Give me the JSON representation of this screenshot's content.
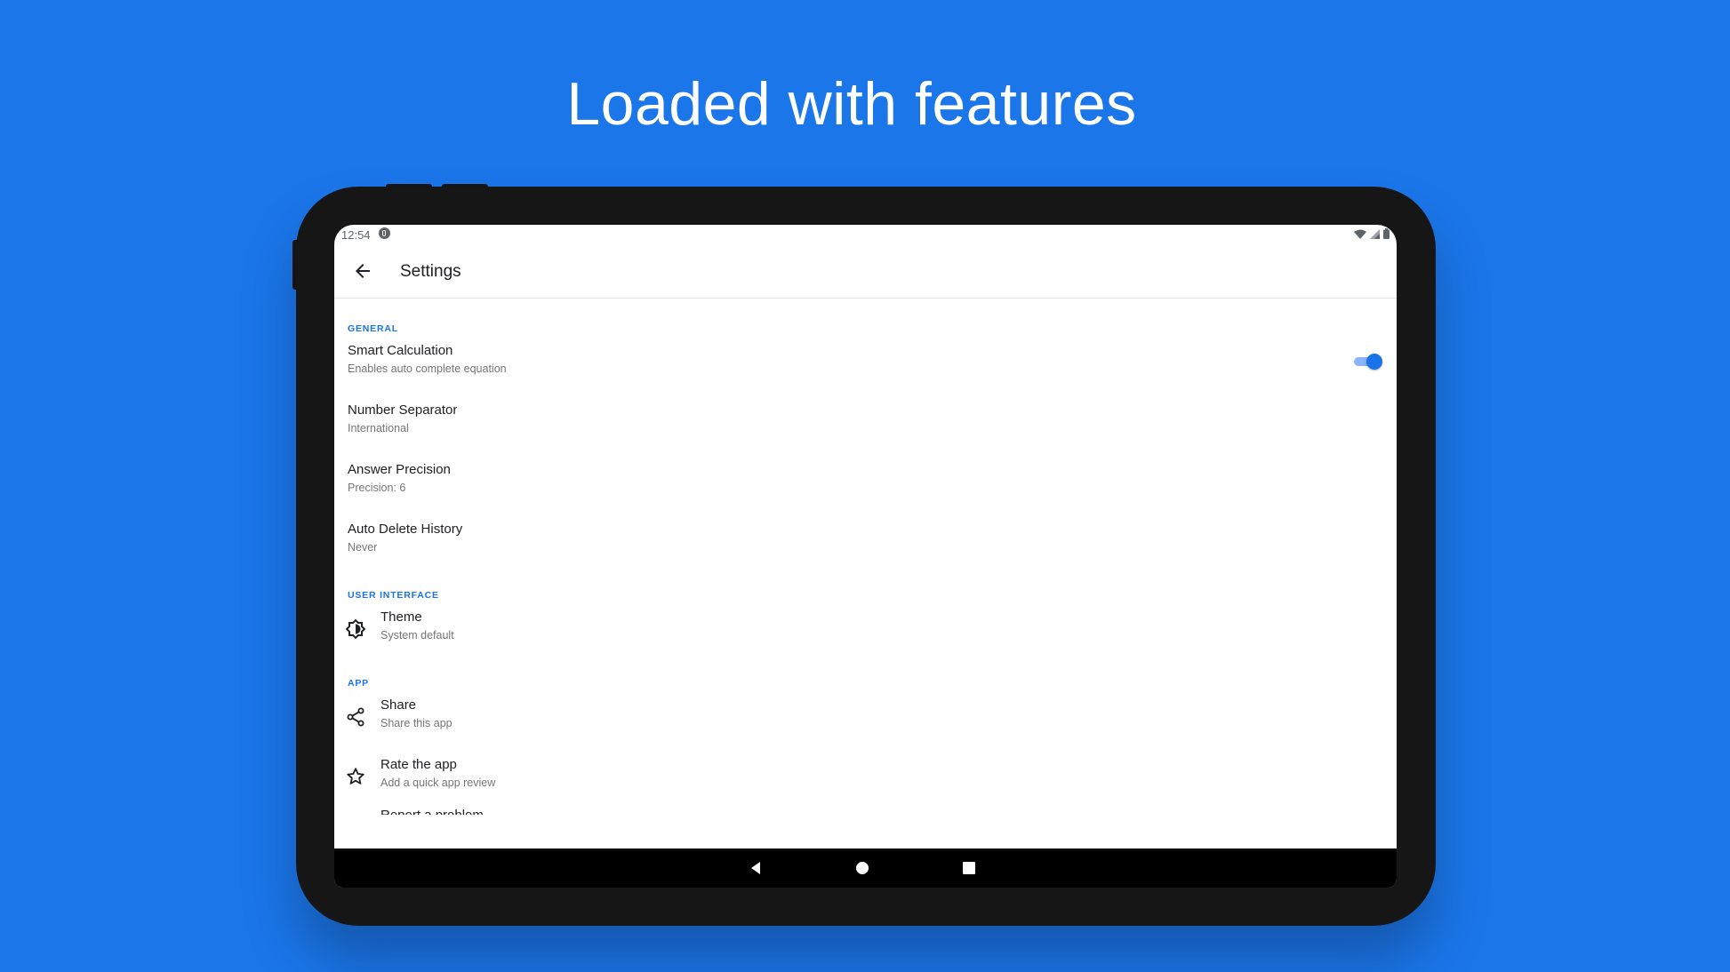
{
  "headline": "Loaded with features",
  "status_bar": {
    "time": "12:54",
    "icons": [
      "notification-icon",
      "wifi-icon",
      "signal-icon",
      "battery-icon"
    ]
  },
  "app_bar": {
    "back_icon": "arrow-back-icon",
    "title": "Settings"
  },
  "sections": {
    "general": {
      "header": "GENERAL",
      "smart_calc": {
        "title": "Smart Calculation",
        "summary": "Enables auto complete equation",
        "enabled": true
      },
      "number_sep": {
        "title": "Number Separator",
        "summary": "International"
      },
      "precision": {
        "title": "Answer Precision",
        "summary": "Precision: 6"
      },
      "auto_delete": {
        "title": "Auto Delete History",
        "summary": "Never"
      }
    },
    "ui": {
      "header": "USER INTERFACE",
      "theme": {
        "title": "Theme",
        "summary": "System default",
        "icon": "theme-icon"
      }
    },
    "app": {
      "header": "APP",
      "share": {
        "title": "Share",
        "summary": "Share this app",
        "icon": "share-icon"
      },
      "rate": {
        "title": "Rate the app",
        "summary": "Add a quick app review",
        "icon": "star-icon"
      },
      "partial_title": "Report a problem"
    }
  },
  "colors": {
    "background": "#1b76ea",
    "accent": "#1a73e8",
    "device": "#161616"
  },
  "nav_bar": {
    "icons": [
      "nav-back-icon",
      "nav-home-icon",
      "nav-recents-icon"
    ]
  }
}
